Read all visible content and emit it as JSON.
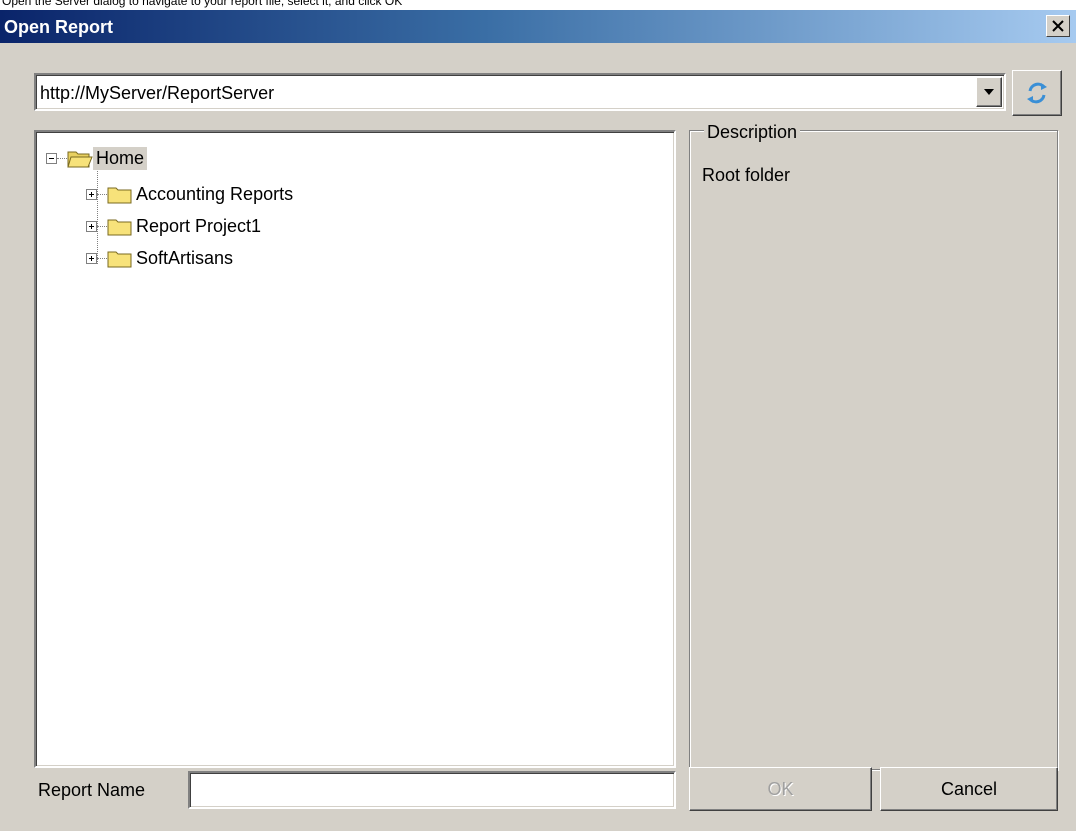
{
  "page_caption": "Open the Server dialog to navigate to your report file, select it, and click OK",
  "window": {
    "title": "Open Report",
    "close_glyph": "×"
  },
  "server": {
    "url": "http://MyServer/ReportServer",
    "refresh_icon": "refresh-icon"
  },
  "tree": {
    "root": {
      "label": "Home",
      "expanded": true,
      "selected": true
    },
    "children": [
      {
        "label": "Accounting Reports",
        "expanded": false
      },
      {
        "label": "Report Project1",
        "expanded": false
      },
      {
        "label": "SoftArtisans",
        "expanded": false
      }
    ]
  },
  "description": {
    "legend": "Description",
    "text": "Root folder"
  },
  "report_name": {
    "label": "Report Name",
    "value": ""
  },
  "buttons": {
    "ok_label": "OK",
    "ok_enabled": false,
    "cancel_label": "Cancel"
  },
  "colors": {
    "titlebar_start": "#0a246a",
    "titlebar_end": "#a6caf0",
    "dialog_face": "#d4d0c8",
    "folder": "#f7e27a"
  }
}
